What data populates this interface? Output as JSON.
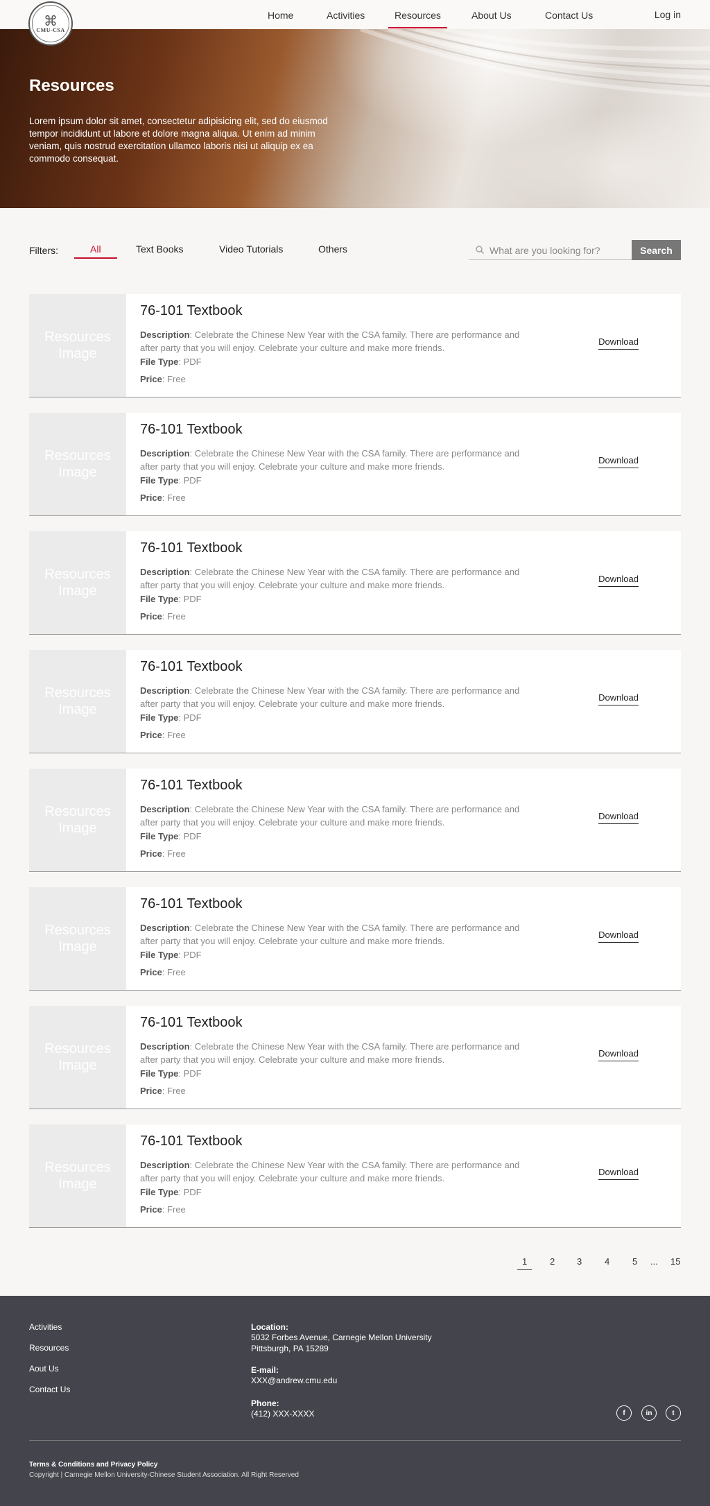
{
  "nav": {
    "logo_text": "CMU-CSA",
    "items": [
      {
        "label": "Home"
      },
      {
        "label": "Activities"
      },
      {
        "label": "Resources"
      },
      {
        "label": "About Us"
      },
      {
        "label": "Contact Us"
      }
    ],
    "active": "Resources",
    "login_label": "Log in"
  },
  "hero": {
    "title": "Resources",
    "text": "Lorem ipsum dolor sit amet, consectetur adipisicing elit, sed do eiusmod tempor incididunt ut labore et dolore magna aliqua. Ut enim ad minim veniam, quis nostrud exercitation ullamco laboris nisi ut aliquip ex ea commodo consequat."
  },
  "filters": {
    "label": "Filters:",
    "options": [
      "All",
      "Text Books",
      "Video Tutorials",
      "Others"
    ],
    "active": "All"
  },
  "search": {
    "placeholder": "What are you looking for?",
    "button_label": "Search"
  },
  "resources": [
    {
      "image_label": "Resources Image",
      "title": "76-101 Textbook",
      "description_label": "Description",
      "description": "Celebrate the Chinese New Year with the CSA family. There are performance and after party that you will enjoy. Celebrate your culture and make more friends.",
      "file_type_label": "File Type",
      "file_type": "PDF",
      "price_label": "Price",
      "price": "Free",
      "action": "Download"
    },
    {
      "image_label": "Resources Image",
      "title": "76-101 Textbook",
      "description_label": "Description",
      "description": "Celebrate the Chinese New Year with the CSA family. There are performance and after party that you will enjoy. Celebrate your culture and make more friends.",
      "file_type_label": "File Type",
      "file_type": "PDF",
      "price_label": "Price",
      "price": "Free",
      "action": "Download"
    },
    {
      "image_label": "Resources Image",
      "title": "76-101 Textbook",
      "description_label": "Description",
      "description": "Celebrate the Chinese New Year with the CSA family. There are performance and after party that you will enjoy. Celebrate your culture and make more friends.",
      "file_type_label": "File Type",
      "file_type": "PDF",
      "price_label": "Price",
      "price": "Free",
      "action": "Download"
    },
    {
      "image_label": "Resources Image",
      "title": "76-101 Textbook",
      "description_label": "Description",
      "description": "Celebrate the Chinese New Year with the CSA family. There are performance and after party that you will enjoy. Celebrate your culture and make more friends.",
      "file_type_label": "File Type",
      "file_type": "PDF",
      "price_label": "Price",
      "price": "Free",
      "action": "Download"
    },
    {
      "image_label": "Resources Image",
      "title": "76-101 Textbook",
      "description_label": "Description",
      "description": "Celebrate the Chinese New Year with the CSA family. There are performance and after party that you will enjoy. Celebrate your culture and make more friends.",
      "file_type_label": "File Type",
      "file_type": "PDF",
      "price_label": "Price",
      "price": "Free",
      "action": "Download"
    },
    {
      "image_label": "Resources Image",
      "title": "76-101 Textbook",
      "description_label": "Description",
      "description": "Celebrate the Chinese New Year with the CSA family. There are performance and after party that you will enjoy. Celebrate your culture and make more friends.",
      "file_type_label": "File Type",
      "file_type": "PDF",
      "price_label": "Price",
      "price": "Free",
      "action": "Download"
    },
    {
      "image_label": "Resources Image",
      "title": "76-101 Textbook",
      "description_label": "Description",
      "description": "Celebrate the Chinese New Year with the CSA family. There are performance and after party that you will enjoy. Celebrate your culture and make more friends.",
      "file_type_label": "File Type",
      "file_type": "PDF",
      "price_label": "Price",
      "price": "Free",
      "action": "Download"
    },
    {
      "image_label": "Resources Image",
      "title": "76-101 Textbook",
      "description_label": "Description",
      "description": "Celebrate the Chinese New Year with the CSA family. There are performance and after party that you will enjoy. Celebrate your culture and make more friends.",
      "file_type_label": "File Type",
      "file_type": "PDF",
      "price_label": "Price",
      "price": "Free",
      "action": "Download"
    }
  ],
  "pagination": {
    "pages": [
      "1",
      "2",
      "3",
      "4",
      "5",
      "...",
      "15"
    ],
    "current": "1"
  },
  "footer": {
    "links": [
      "Activities",
      "Resources",
      "Aout Us",
      "Contact Us"
    ],
    "location_label": "Location:",
    "location_line1": "5032 Forbes Avenue, Carnegie Mellon University",
    "location_line2": "Pittsburgh, PA 15289",
    "email_label": "E-mail:",
    "email": "XXX@andrew.cmu.edu",
    "phone_label": "Phone:",
    "phone": "(412) XXX-XXXX",
    "social": [
      {
        "icon": "facebook-icon",
        "glyph": "f"
      },
      {
        "icon": "linkedin-icon",
        "glyph": "in"
      },
      {
        "icon": "twitter-icon",
        "glyph": "t"
      }
    ],
    "terms": "Terms & Conditions and Privacy Policy",
    "copyright": "Copyright |  Carnegie Mellon University-Chinese Student Association. All Right Reserved"
  }
}
